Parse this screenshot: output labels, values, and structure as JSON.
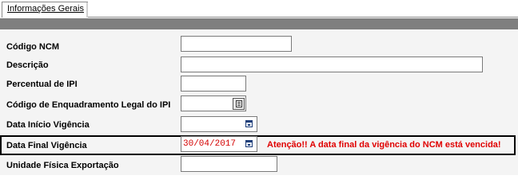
{
  "tab": {
    "label": "Informações Gerais"
  },
  "fields": {
    "codigo_ncm": {
      "label": "Código NCM",
      "value": ""
    },
    "descricao": {
      "label": "Descrição",
      "value": ""
    },
    "percentual_ipi": {
      "label": "Percentual de IPI",
      "value": ""
    },
    "enquadramento_ipi": {
      "label": "Código de Enquadramento Legal do IPI",
      "value": ""
    },
    "data_inicio": {
      "label": "Data Início Vigência",
      "value": ""
    },
    "data_final": {
      "label": "Data Final Vigência",
      "value": "30/04/2017"
    },
    "unidade_fisica": {
      "label": "Unidade Física Exportação",
      "value": ""
    }
  },
  "warning": {
    "text": "Atenção!! A data final da vigência do NCM está vencida!"
  },
  "colors": {
    "header_bar": "#7f7f7f",
    "warning": "#e00000",
    "date_value": "#d40000"
  },
  "icons": {
    "lookup": "list-lookup-icon",
    "calendar": "calendar-icon"
  }
}
